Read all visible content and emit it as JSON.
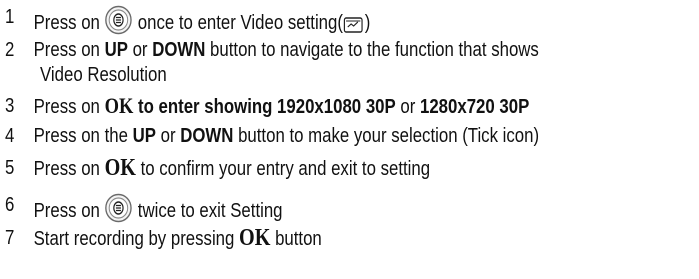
{
  "steps": [
    {
      "num": "1",
      "a": "Press on ",
      "b": " once to enter Video setting(",
      "c": ")"
    },
    {
      "num": "2",
      "a": "Press on ",
      "up": "UP",
      "or": " or ",
      "down": "DOWN",
      "b": " button to navigate to the function that shows",
      "line2": "Video Resolution"
    },
    {
      "num": "3",
      "a": "Press on ",
      "ok": "OK",
      "b": " to enter showing 1920x1080 30P",
      "or": " or ",
      "c": "1280x720 30P"
    },
    {
      "num": "4",
      "a": "Press on the ",
      "up": "UP",
      "or": " or ",
      "down": "DOWN",
      "b": " button to make your selection (Tick icon)"
    },
    {
      "num": "5",
      "a": "Press on ",
      "ok": "OK",
      "b": "  to confirm your entry and exit to setting"
    },
    {
      "num": "6",
      "a": "Press on ",
      "b": " twice to exit Setting"
    },
    {
      "num": "7",
      "a": "Start recording by pressing ",
      "ok": "OK",
      "b": " button"
    }
  ],
  "icons": {
    "menu_button": "menu-button-icon",
    "video_setting": "video-setting-icon"
  },
  "colors": {
    "text": "#111111",
    "icon_ring": "#6a6a6a"
  }
}
